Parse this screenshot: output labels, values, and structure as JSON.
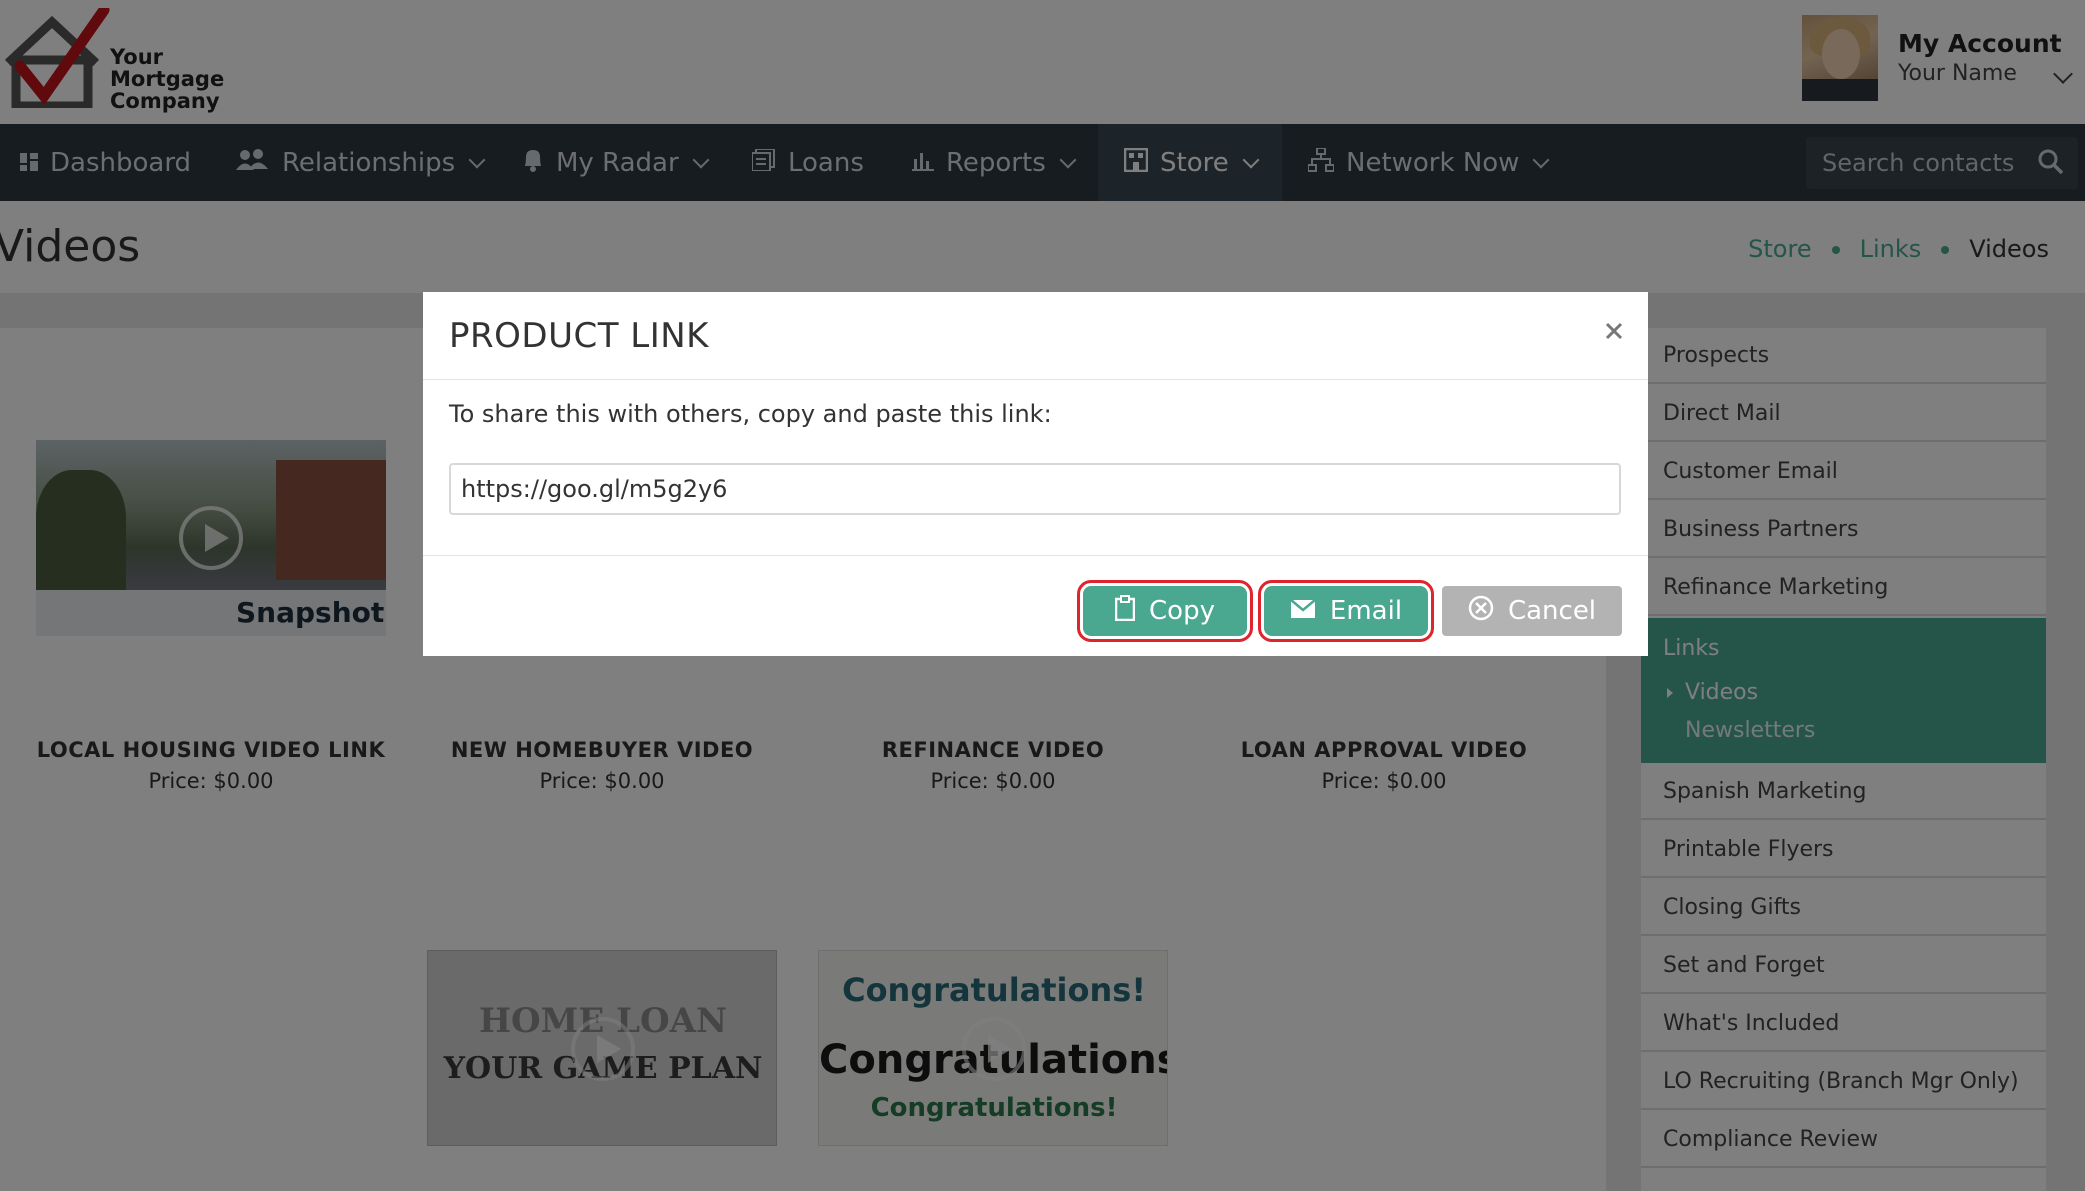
{
  "header": {
    "logo_lines": [
      "Your",
      "Mortgage",
      "Company"
    ],
    "account_title": "My Account",
    "account_name": "Your Name"
  },
  "nav": {
    "items": [
      {
        "label": "Dashboard",
        "icon": "dashboard-icon"
      },
      {
        "label": "Relationships",
        "icon": "people-icon"
      },
      {
        "label": "My Radar",
        "icon": "bell-icon"
      },
      {
        "label": "Loans",
        "icon": "document-icon"
      },
      {
        "label": "Reports",
        "icon": "bar-chart-icon"
      },
      {
        "label": "Store",
        "icon": "store-icon"
      },
      {
        "label": "Network Now",
        "icon": "network-icon"
      }
    ],
    "search_placeholder": "Search contacts"
  },
  "page": {
    "title": "Videos",
    "breadcrumb": [
      "Store",
      "Links",
      "Videos"
    ]
  },
  "products": [
    {
      "name": "LOCAL HOUSING VIDEO LINK",
      "price": "Price: $0.00",
      "thumb_text": "Snapshot"
    },
    {
      "name": "NEW HOMEBUYER VIDEO",
      "price": "Price: $0.00"
    },
    {
      "name": "REFINANCE VIDEO",
      "price": "Price: $0.00"
    },
    {
      "name": "LOAN APPROVAL VIDEO",
      "price": "Price: $0.00"
    },
    {
      "name": "",
      "price": "",
      "thumb_lines": [
        "HOME LOAN",
        "YOUR GAME PLAN"
      ]
    },
    {
      "name": "",
      "price": "",
      "thumb_lines": [
        "Congratulations!",
        "Congratulations!",
        "Congratulations!"
      ]
    }
  ],
  "sidebar": {
    "items_top": [
      "Prospects",
      "Direct Mail",
      "Customer Email",
      "Business Partners",
      "Refinance Marketing"
    ],
    "active": {
      "label": "Links",
      "sub_selected": "Videos",
      "sub_other": "Newsletters"
    },
    "items_bottom": [
      "Spanish Marketing",
      "Printable Flyers",
      "Closing Gifts",
      "Set and Forget",
      "What's Included",
      "LO Recruiting (Branch Mgr Only)",
      "Compliance Review"
    ]
  },
  "modal": {
    "title": "PRODUCT LINK",
    "instruction": "To share this with others, copy and paste this link:",
    "link": "https://goo.gl/m5g2y6",
    "copy_label": "Copy",
    "email_label": "Email",
    "cancel_label": "Cancel"
  },
  "colors": {
    "accent": "#4aa890",
    "nav_bg": "#2d3840",
    "highlight": "#e0242e"
  }
}
